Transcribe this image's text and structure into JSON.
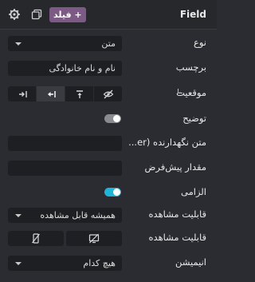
{
  "header": {
    "title": "Field",
    "add_badge": "+ فیلد",
    "gear_icon": "gear-icon",
    "duplicate_icon": "duplicate-icon"
  },
  "rows": {
    "type": {
      "label": "نوع",
      "value": "متن"
    },
    "tag": {
      "label": "برچسب",
      "value": "نام و نام خانوادگی"
    },
    "position": {
      "label": "موقعیت",
      "options": [
        "label-right",
        "label-left",
        "label-top",
        "label-hidden"
      ],
      "active_index": 1
    },
    "description": {
      "label": "توضیح",
      "toggle_on": false
    },
    "placeholder": {
      "label": "متن نگهدارنده (er...",
      "value": ""
    },
    "default": {
      "label": "مقدار پیش‌فرض",
      "value": ""
    },
    "required": {
      "label": "الزامی",
      "toggle_on": true
    },
    "visibility": {
      "label": "قابلیت مشاهده",
      "value": "همیشه قابل مشاهده"
    },
    "visibility_devices": {
      "label": "قابلیت مشاهده",
      "options": [
        "hide-on-mobile",
        "hide-on-desktop"
      ]
    },
    "animation": {
      "label": "انیمیشن",
      "value": "هیچ کدام"
    }
  },
  "colors": {
    "panel": "#2b2c31",
    "input": "#1e1f23",
    "badge": "#7d5a86",
    "toggle_on": "#1fb5d8"
  }
}
